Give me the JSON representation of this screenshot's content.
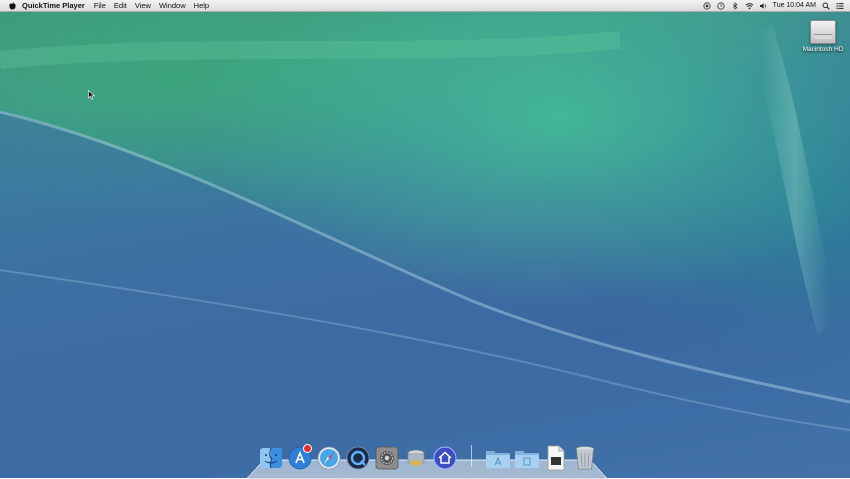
{
  "menubar": {
    "apple_icon": "apple-icon",
    "app_name": "QuickTime Player",
    "items": [
      "File",
      "Edit",
      "View",
      "Window",
      "Help"
    ],
    "status_icons": [
      "record-icon",
      "time-machine-icon",
      "bluetooth-icon",
      "wifi-icon",
      "volume-icon"
    ],
    "clock": "Tue 10:04 AM",
    "spotlight_icon": "spotlight-search-icon",
    "notification_icon": "notification-center-icon"
  },
  "desktop": {
    "drive_label": "Macintosh HD"
  },
  "dock": {
    "items": [
      {
        "name": "finder",
        "icon": "finder-icon"
      },
      {
        "name": "app-store",
        "icon": "app-store-icon",
        "badge": true
      },
      {
        "name": "safari",
        "icon": "safari-icon"
      },
      {
        "name": "quicktime",
        "icon": "quicktime-icon"
      },
      {
        "name": "system-preferences",
        "icon": "system-preferences-icon"
      },
      {
        "name": "disk-utility",
        "icon": "disk-utility-icon"
      },
      {
        "name": "home",
        "icon": "home-icon"
      },
      {
        "name": "applications-folder",
        "icon": "applications-folder-icon"
      },
      {
        "name": "documents-folder",
        "icon": "documents-folder-icon"
      },
      {
        "name": "document",
        "icon": "document-icon"
      },
      {
        "name": "trash",
        "icon": "trash-icon"
      }
    ]
  },
  "colors": {
    "wave_green": "#3d9a78",
    "ocean_blue": "#3b67a0",
    "menubar": "#e6e6e6"
  }
}
